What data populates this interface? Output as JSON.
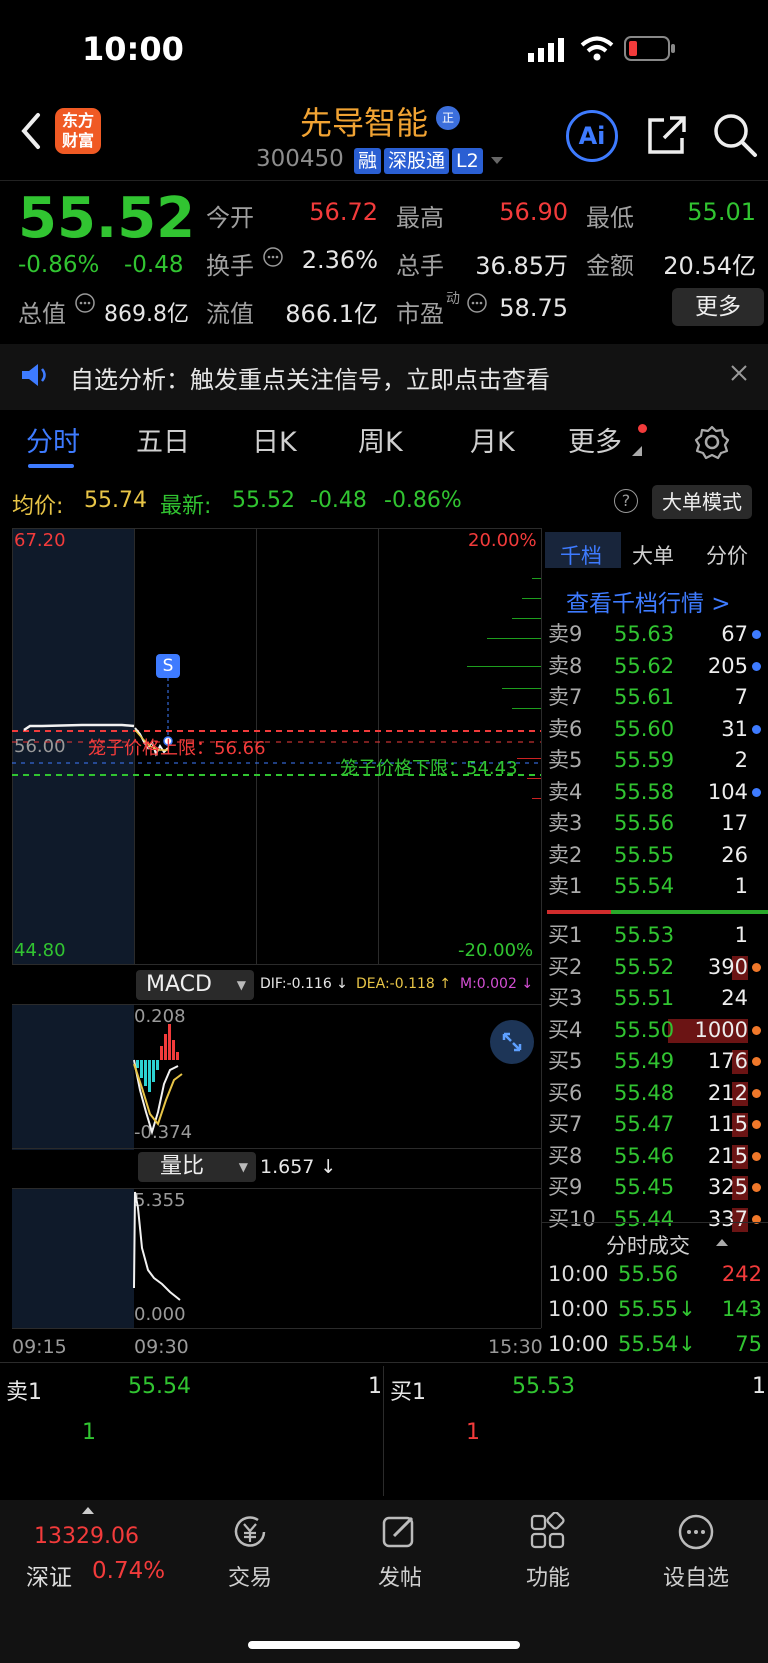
{
  "status_bar": {
    "time": "10:00"
  },
  "header": {
    "back_icon": "chevron-left-icon",
    "logo_text_1": "东方",
    "logo_text_2": "财富",
    "stock_name": "先导智能",
    "stock_badge": "正",
    "stock_code": "300450",
    "tags": [
      "融",
      "深股通",
      "L2"
    ],
    "ai_label": "Ai"
  },
  "quote": {
    "price": "55.52",
    "change_pct": "-0.86%",
    "change": "-0.48",
    "open_label": "今开",
    "open": "56.72",
    "high_label": "最高",
    "high": "56.90",
    "low_label": "最低",
    "low": "55.01",
    "turnover_label": "换手",
    "turnover": "2.36%",
    "volume_label": "总手",
    "volume": "36.85万",
    "amount_label": "金额",
    "amount": "20.54亿",
    "total_cap_label": "总值",
    "total_cap": "869.8亿",
    "float_cap_label": "流值",
    "float_cap": "866.1亿",
    "pe_label": "市盈",
    "pe_sup": "动",
    "pe": "58.75",
    "more_label": "更多"
  },
  "notice": {
    "text": "自选分析：触发重点关注信号，立即点击查看"
  },
  "tabs": [
    "分时",
    "五日",
    "日K",
    "周K",
    "月K",
    "更多"
  ],
  "info": {
    "avg_label": "均价:",
    "avg": "55.74",
    "latest_label": "最新:",
    "latest": "55.52",
    "chg": "-0.48",
    "pct": "-0.86%",
    "help": "?",
    "mode_label": "大单模式"
  },
  "chart": {
    "y_top": "67.20",
    "y_bottom": "44.80",
    "y_mid": "56.00",
    "pct_top": "20.00%",
    "pct_bottom": "-20.00%",
    "upper_limit_label": "笼子价格上限：56.66",
    "lower_limit_label": "笼子价格下限：54.43",
    "s_marker": "S",
    "time_start": "09:15",
    "time_open": "09:30",
    "time_end": "15:30",
    "colors": {
      "up": "#f23b3b",
      "down": "#31c431",
      "accent": "#3e7bff"
    }
  },
  "macd": {
    "label": "MACD",
    "dif": "DIF:-0.116 ↓",
    "dea": "DEA:-0.118 ↑",
    "m": "M:0.002 ↓",
    "top": "0.208",
    "bottom": "-0.374"
  },
  "volratio": {
    "label": "量比",
    "value": "1.657 ↓",
    "top": "5.355",
    "bottom": "0.000"
  },
  "orderbook": {
    "tabs": [
      "千档",
      "大单",
      "分价"
    ],
    "link": "查看千档行情 >",
    "asks": [
      {
        "label": "卖9",
        "price": "55.63",
        "qty": "67"
      },
      {
        "label": "卖8",
        "price": "55.62",
        "qty": "205"
      },
      {
        "label": "卖7",
        "price": "55.61",
        "qty": "7"
      },
      {
        "label": "卖6",
        "price": "55.60",
        "qty": "31"
      },
      {
        "label": "卖5",
        "price": "55.59",
        "qty": "2"
      },
      {
        "label": "卖4",
        "price": "55.58",
        "qty": "104"
      },
      {
        "label": "卖3",
        "price": "55.56",
        "qty": "17"
      },
      {
        "label": "卖2",
        "price": "55.55",
        "qty": "26"
      },
      {
        "label": "卖1",
        "price": "55.54",
        "qty": "1"
      }
    ],
    "bids": [
      {
        "label": "买1",
        "price": "55.53",
        "qty": "1"
      },
      {
        "label": "买2",
        "price": "55.52",
        "qty": "390"
      },
      {
        "label": "买3",
        "price": "55.51",
        "qty": "24"
      },
      {
        "label": "买4",
        "price": "55.50",
        "qty": "1000"
      },
      {
        "label": "买5",
        "price": "55.49",
        "qty": "176"
      },
      {
        "label": "买6",
        "price": "55.48",
        "qty": "212"
      },
      {
        "label": "买7",
        "price": "55.47",
        "qty": "115"
      },
      {
        "label": "买8",
        "price": "55.46",
        "qty": "215"
      },
      {
        "label": "买9",
        "price": "55.45",
        "qty": "325"
      },
      {
        "label": "买10",
        "price": "55.44",
        "qty": "337"
      }
    ]
  },
  "ticks": {
    "title": "分时成交",
    "rows": [
      {
        "time": "10:00",
        "price": "55.56",
        "qty": "242"
      },
      {
        "time": "10:00",
        "price": "55.55↓",
        "qty": "143"
      },
      {
        "time": "10:00",
        "price": "55.54↓",
        "qty": "75"
      }
    ]
  },
  "bottom_quotes": {
    "ask_label": "卖1",
    "ask_price": "55.54",
    "ask_qty": "1",
    "ask_sub": "1",
    "bid_label": "买1",
    "bid_price": "55.53",
    "bid_qty": "1",
    "bid_sub": "1"
  },
  "nav": {
    "index_value": "13329.06",
    "index_name": "深证",
    "index_pct": "0.74%",
    "items": [
      "交易",
      "发帖",
      "功能",
      "设自选"
    ]
  }
}
